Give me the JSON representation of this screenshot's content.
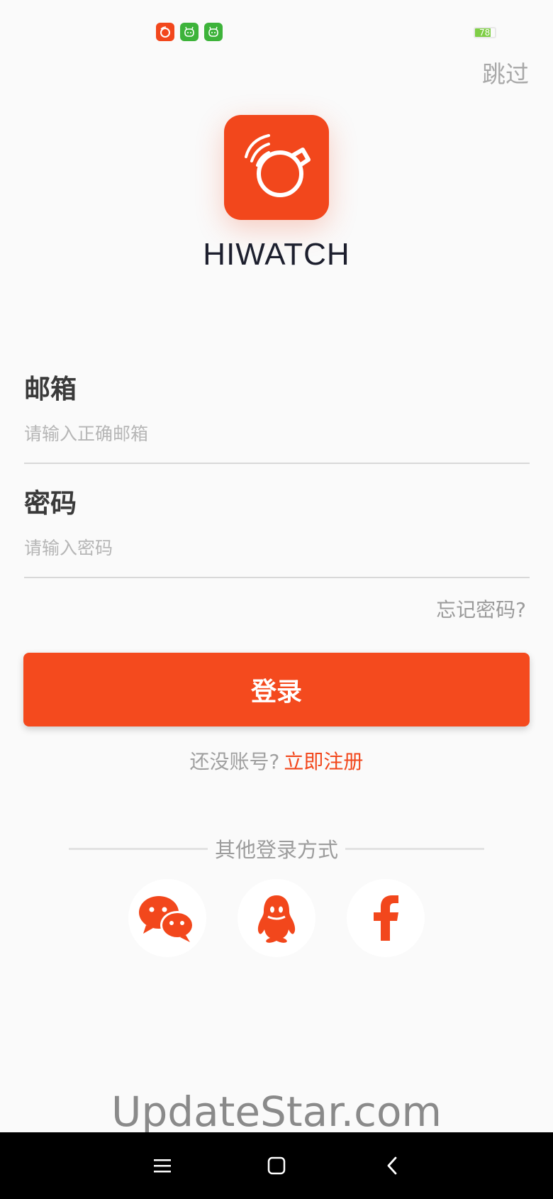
{
  "status_bar": {
    "battery_text": "78",
    "battery_level": 0.78,
    "battery_color": "#7fce46",
    "app_icons": [
      "hiwatch-icon",
      "android-icon",
      "android-icon"
    ]
  },
  "header": {
    "skip_label": "跳过"
  },
  "app": {
    "name": "HIWATCH",
    "brand_color": "#f2471c",
    "logo_icon": "smartwatch-icon"
  },
  "form": {
    "email_label": "邮箱",
    "email_placeholder": "请输入正确邮箱",
    "email_value": "",
    "password_label": "密码",
    "password_placeholder": "请输入密码",
    "password_value": "",
    "forgot_label": "忘记密码?"
  },
  "login_button": {
    "label": "登录"
  },
  "register": {
    "prompt": "还没账号?",
    "link": "立即注册"
  },
  "other_login": {
    "label": "其他登录方式",
    "providers": [
      {
        "name": "wechat",
        "icon": "wechat-icon"
      },
      {
        "name": "qq",
        "icon": "qq-icon"
      },
      {
        "name": "facebook",
        "icon": "facebook-icon"
      }
    ]
  },
  "watermark": {
    "text": "UpdateStar.com"
  },
  "nav_bar": {
    "icons": [
      "menu-icon",
      "home-square-icon",
      "back-chevron-icon"
    ]
  }
}
